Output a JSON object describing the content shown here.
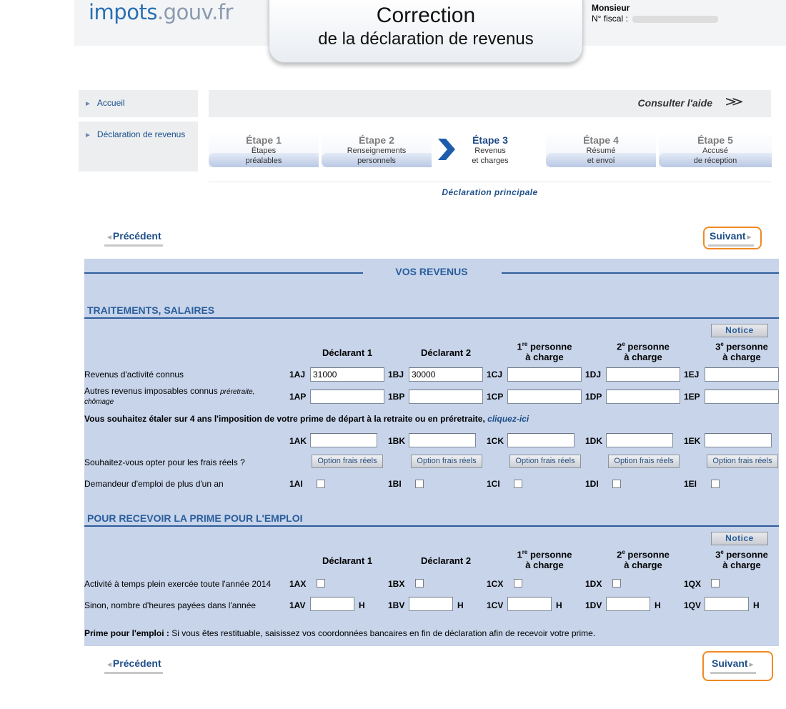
{
  "header": {
    "logo_main": "impots",
    "logo_domain": ".gouv.fr",
    "title_line1": "Correction",
    "title_line2": "de la déclaration de revenus",
    "user_label": "Monsieur",
    "fiscal_label": "N° fiscal :"
  },
  "sidebar": {
    "items": [
      {
        "label": "Accueil"
      },
      {
        "label": "Déclaration de revenus"
      }
    ]
  },
  "help": {
    "label": "Consulter l'aide",
    "icon": "double-chevron-down-icon"
  },
  "steps": [
    {
      "num": "Étape 1",
      "line1": "Étapes",
      "line2": "préalables"
    },
    {
      "num": "Étape 2",
      "line1": "Renseignements",
      "line2": "personnels"
    },
    {
      "num": "Étape 3",
      "line1": "Revenus",
      "line2": "et charges"
    },
    {
      "num": "Étape 4",
      "line1": "Résumé",
      "line2": "et envoi"
    },
    {
      "num": "Étape 5",
      "line1": "Accusé",
      "line2": "de réception"
    }
  ],
  "active_step": "Étape 3",
  "declaration_label": "Déclaration principale",
  "nav": {
    "prev": "Précédent",
    "next": "Suivant"
  },
  "panel": {
    "title": "VOS REVENUS",
    "notice_label": "Notice",
    "columns": {
      "d1": "Déclarant 1",
      "d2": "Déclarant 2",
      "p1_sup": "re",
      "p2_sup": "e",
      "p3_sup": "e",
      "p1_head": "1",
      "p2_head": "2",
      "p3_head": "3",
      "person_word": "personne",
      "charge_word": "à charge"
    },
    "section1": {
      "title": "TRAITEMENTS, SALAIRES",
      "row1_label": "Revenus d'activité connus",
      "row1_codes": [
        "1AJ",
        "1BJ",
        "1CJ",
        "1DJ",
        "1EJ"
      ],
      "row1_values": [
        "31000",
        "30000",
        "",
        "",
        ""
      ],
      "row2_label": "Autres revenus imposables connus",
      "row2_hint_a": "préretraite,",
      "row2_hint_b": "chômage",
      "row2_codes": [
        "1AP",
        "1BP",
        "1CP",
        "1DP",
        "1EP"
      ],
      "retraite_text": "Vous souhaitez étaler sur 4 ans l'imposition de votre prime de départ à la retraite ou en préretraite,",
      "retraite_link": "cliquez-ici",
      "row3_codes": [
        "1AK",
        "1BK",
        "1CK",
        "1DK",
        "1EK"
      ],
      "frais_label": "Souhaitez-vous opter pour les frais réels ?",
      "frais_button": "Option frais réels",
      "demandeur_label": "Demandeur d'emploi de plus d'un an",
      "demandeur_codes": [
        "1AI",
        "1BI",
        "1CI",
        "1DI",
        "1EI"
      ]
    },
    "section2": {
      "title": "POUR RECEVOIR LA PRIME POUR L'EMPLOI",
      "activite_label": "Activité à temps plein exercée toute l'année 2014",
      "activite_codes": [
        "1AX",
        "1BX",
        "1CX",
        "1DX",
        "1QX"
      ],
      "heures_label": "Sinon, nombre d'heures payées dans l'année",
      "heures_codes": [
        "1AV",
        "1BV",
        "1CV",
        "1DV",
        "1QV"
      ],
      "heures_unit": "H",
      "prime_bold": "Prime pour l'emploi :",
      "prime_text": " Si vous êtes restituable, saisissez vos coordonnées bancaires en fin de déclaration afin de recevoir votre prime."
    }
  }
}
